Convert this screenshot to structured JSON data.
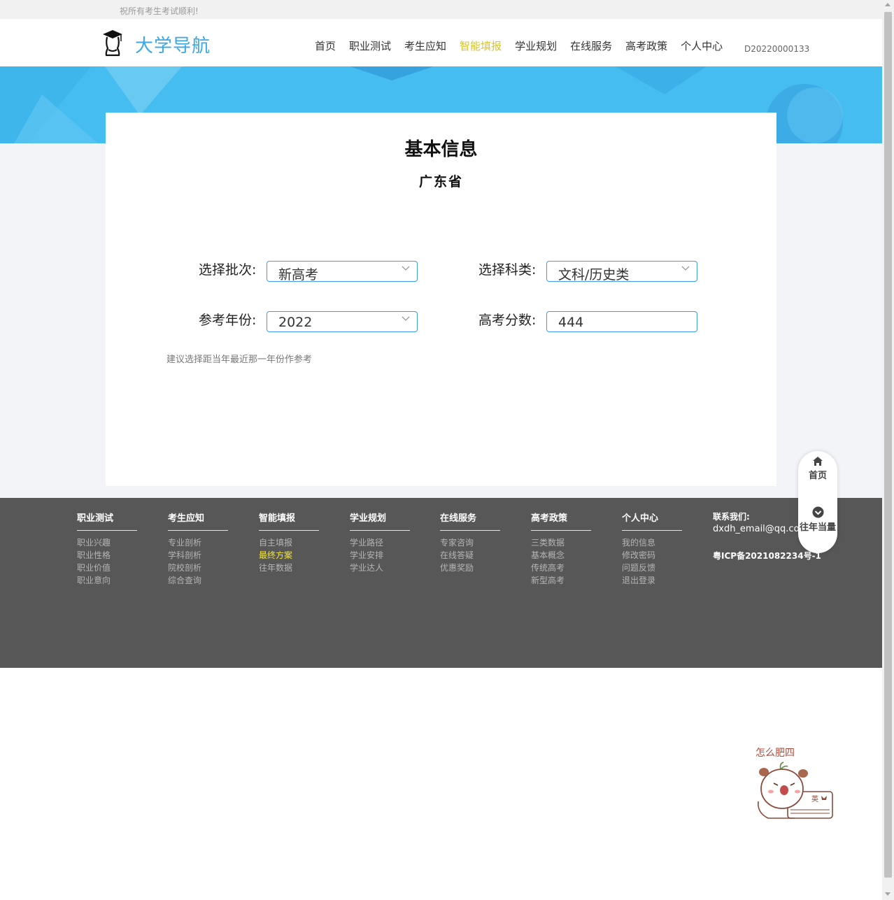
{
  "topbar": {
    "message": "祝所有考生考试顺利!"
  },
  "header": {
    "brand": "大学导航",
    "nav": [
      {
        "label": "首页",
        "active": false
      },
      {
        "label": "职业测试",
        "active": false
      },
      {
        "label": "考生应知",
        "active": false
      },
      {
        "label": "智能填报",
        "active": true
      },
      {
        "label": "学业规划",
        "active": false
      },
      {
        "label": "在线服务",
        "active": false
      },
      {
        "label": "高考政策",
        "active": false
      },
      {
        "label": "个人中心",
        "active": false
      }
    ],
    "user_id": "D20220000133"
  },
  "form": {
    "title": "基本信息",
    "province": "广东省",
    "batch_label": "选择批次:",
    "batch_value": "新高考",
    "subject_label": "选择科类:",
    "subject_value": "文科/历史类",
    "year_label": "参考年份:",
    "year_value": "2022",
    "score_label": "高考分数:",
    "score_value": "444",
    "hint": "建议选择距当年最近那一年份作参考"
  },
  "footer": {
    "columns": [
      {
        "title": "职业测试",
        "links": [
          "职业兴趣",
          "职业性格",
          "职业价值",
          "职业意向"
        ]
      },
      {
        "title": "考生应知",
        "links": [
          "专业剖析",
          "学科剖析",
          "院校剖析",
          "综合查询"
        ]
      },
      {
        "title": "智能填报",
        "links": [
          "自主填报",
          "最终方案",
          "往年数据"
        ]
      },
      {
        "title": "学业规划",
        "links": [
          "学业路径",
          "学业安排",
          "学业达人"
        ]
      },
      {
        "title": "在线服务",
        "links": [
          "专家咨询",
          "在线答疑",
          "优惠奖励"
        ]
      },
      {
        "title": "高考政策",
        "links": [
          "三类数据",
          "基本概念",
          "传统高考",
          "新型高考"
        ]
      },
      {
        "title": "个人中心",
        "links": [
          "我的信息",
          "修改密码",
          "问题反馈",
          "退出登录"
        ]
      }
    ],
    "contact_label": "联系我们:",
    "contact_email": "dxdh_email@qq.com",
    "icp": "粤ICP备2021082234号-1"
  },
  "float_nav": {
    "home": "首页",
    "equivalent": "往年当量"
  },
  "mascot": {
    "caption": "怎么肥四",
    "book_text": "英"
  },
  "colors": {
    "brand": "#3aa7e8",
    "active_nav": "#d7c33a",
    "banner": "#46bdf0",
    "footer": "#575757",
    "highlight_link": "#f5e72a"
  }
}
